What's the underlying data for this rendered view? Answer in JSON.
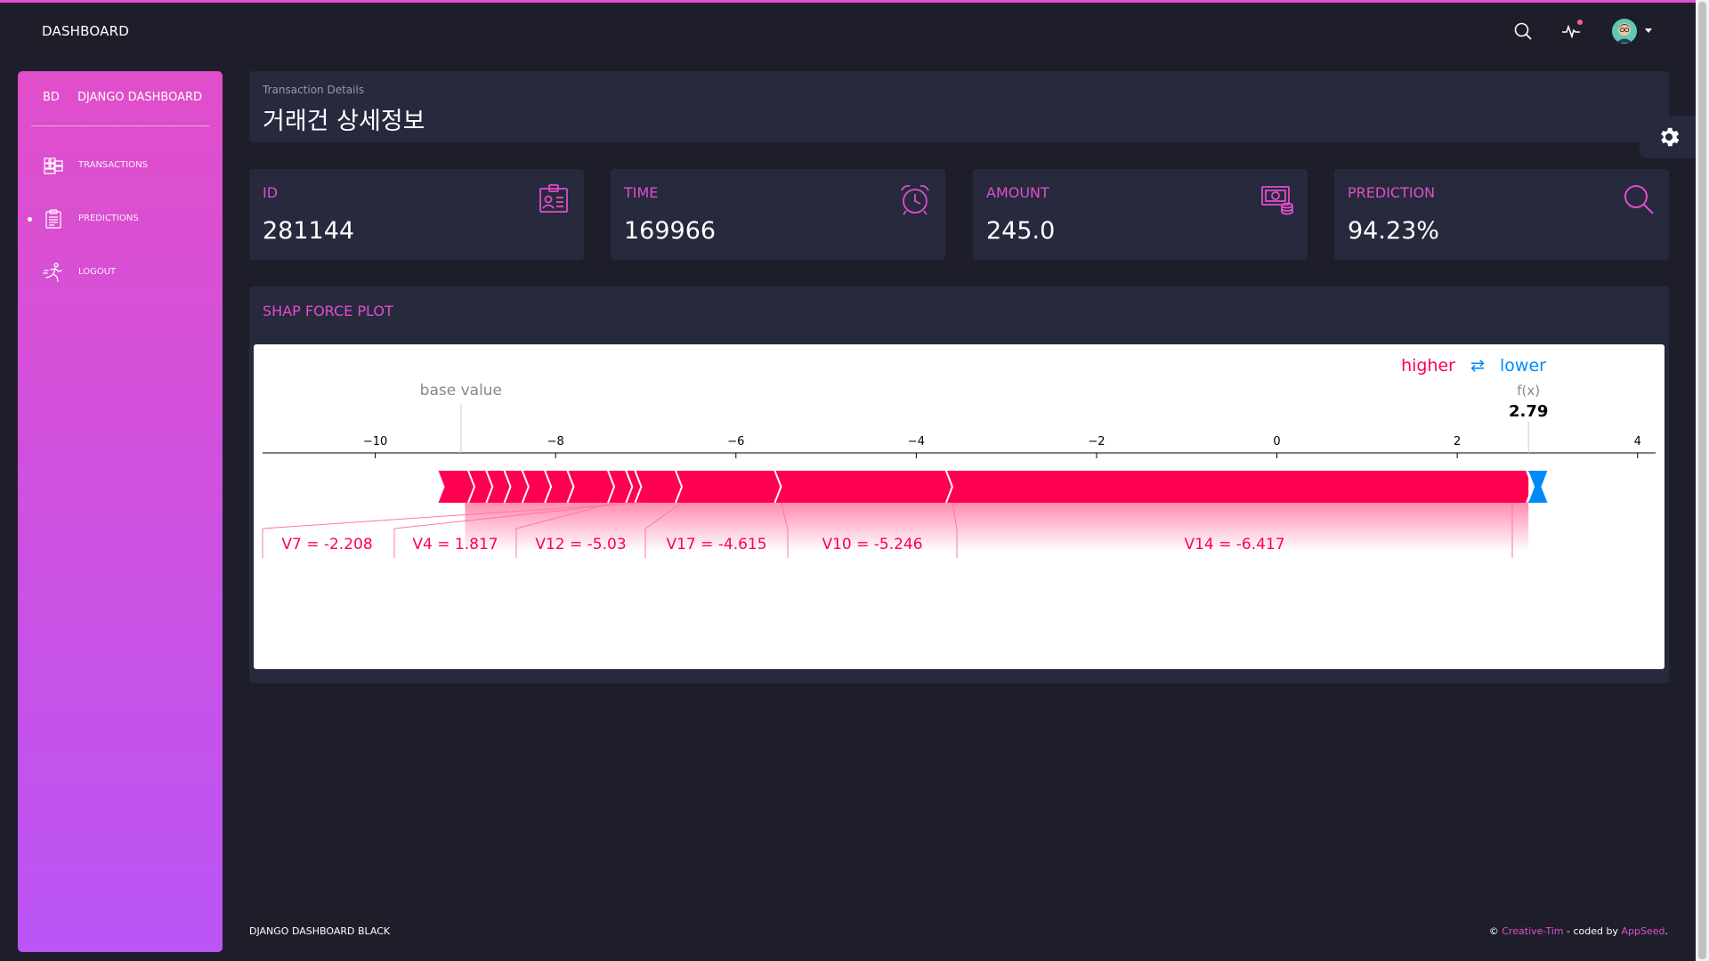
{
  "navbar": {
    "brand": "DASHBOARD"
  },
  "sidebar": {
    "logo_mini": "BD",
    "logo_normal": "DJANGO DASHBOARD",
    "items": [
      {
        "label": "TRANSACTIONS",
        "icon": "money-stack-icon",
        "active": false
      },
      {
        "label": "PREDICTIONS",
        "icon": "clipboard-icon",
        "active": true
      },
      {
        "label": "LOGOUT",
        "icon": "runner-icon",
        "active": false
      }
    ]
  },
  "header": {
    "subtitle": "Transaction Details",
    "title": "거래건 상세정보"
  },
  "stats": [
    {
      "label": "ID",
      "value": "281144",
      "icon": "id-card-icon"
    },
    {
      "label": "TIME",
      "value": "169966",
      "icon": "alarm-clock-icon"
    },
    {
      "label": "AMOUNT",
      "value": "245.0",
      "icon": "money-icon"
    },
    {
      "label": "PREDICTION",
      "value": "94.23%",
      "icon": "search-icon"
    }
  ],
  "shap": {
    "title": "SHAP FORCE PLOT"
  },
  "chart_data": {
    "type": "force",
    "base_value_label": "base value",
    "base_value": -9.05,
    "fx_label": "f(x)",
    "fx_value_text": "2.79",
    "fx_value": 2.79,
    "legend_higher": "higher",
    "legend_lower": "lower",
    "legend_arrows": "⇄",
    "x_ticks": [
      -10,
      -8,
      -6,
      -4,
      -2,
      0,
      2,
      4
    ],
    "x_tick_labels": [
      "−10",
      "−8",
      "−6",
      "−4",
      "−2",
      "0",
      "2",
      "4"
    ],
    "xlim": [
      -11.25,
      4.2
    ],
    "labeled_features": [
      {
        "label": "V7 = -2.208",
        "start": -7.15,
        "end": -7.05
      },
      {
        "label": "V4 = 1.817",
        "start": -7.35,
        "end": -7.15
      },
      {
        "label": "V12 = -5.03",
        "start": -6.6,
        "end": -7.35
      },
      {
        "label": "V17 = -4.615",
        "start": -5.5,
        "end": -6.6
      },
      {
        "label": "V10 = -5.246",
        "start": -3.6,
        "end": -5.5
      },
      {
        "label": "V14 = -6.417",
        "start": 2.79,
        "end": -3.6
      }
    ],
    "small_chevrons_positive": [
      -8.9,
      -8.7,
      -8.5,
      -8.3,
      -8.05,
      -7.8
    ],
    "positive_start": -9.3,
    "negative_end": 3.0,
    "colors": {
      "positive": "#ff0051",
      "negative": "#008bfb"
    }
  },
  "footer": {
    "left": "DJANGO DASHBOARD BLACK",
    "copyright": "©",
    "author": "Creative-Tim",
    "coded_by": "- coded by",
    "coder": "AppSeed",
    "end": "."
  },
  "colors": {
    "accent": "#e14eca",
    "accent2": "#ba54f5",
    "background": "#1e1e2b",
    "card": "#27293d"
  }
}
